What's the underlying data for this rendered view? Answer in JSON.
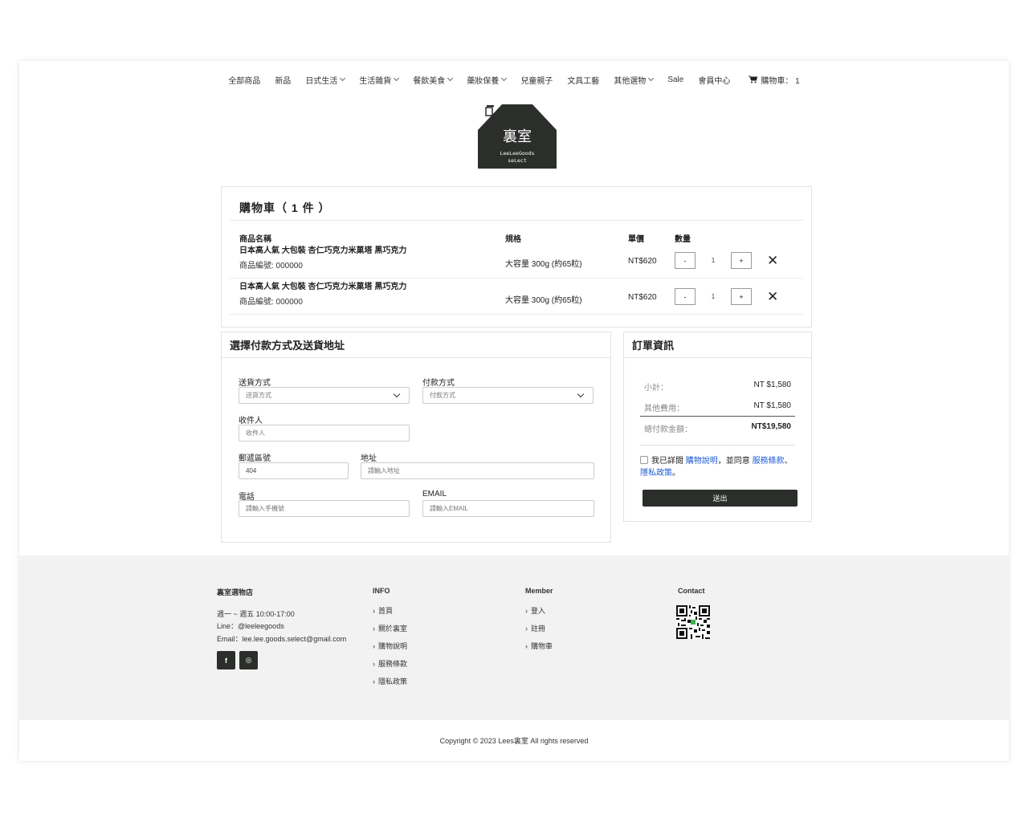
{
  "nav": {
    "items": [
      {
        "label": "全部商品",
        "has_dropdown": false
      },
      {
        "label": "新品",
        "has_dropdown": false
      },
      {
        "label": "日式生活",
        "has_dropdown": true
      },
      {
        "label": "生活雜貨",
        "has_dropdown": true
      },
      {
        "label": "餐飲美食",
        "has_dropdown": true
      },
      {
        "label": "藥妝保養",
        "has_dropdown": true
      },
      {
        "label": "兒童親子",
        "has_dropdown": false
      },
      {
        "label": "文具工藝",
        "has_dropdown": false
      },
      {
        "label": "其他選物",
        "has_dropdown": true
      },
      {
        "label": "Sale",
        "has_dropdown": false
      },
      {
        "label": "會員中心",
        "has_dropdown": false
      }
    ],
    "cart_label": "購物車： 1"
  },
  "logo": {
    "title": "裏室",
    "line1": "LeeLeeGoods",
    "line2": "seLect",
    "color": "#2b2e2a"
  },
  "cart": {
    "title": "購物車（ 1 件 ）",
    "headers": {
      "name": "商品名稱",
      "spec": "規格",
      "price": "單價",
      "qty": "數量"
    },
    "rows": [
      {
        "name": "日本高人氣 大包裝 杏仁巧克力米菓塔 黑巧克力",
        "code": "商品編號: 000000",
        "spec": "大容量 300g (約65粒)",
        "price": "NT$620",
        "qty": "1"
      },
      {
        "name": "日本高人氣 大包裝 杏仁巧克力米菓塔 黑巧克力",
        "code": "商品編號: 000000",
        "spec": "大容量 300g (約65粒)",
        "price": "NT$620",
        "qty": "1"
      }
    ],
    "minus": "-",
    "plus": "+",
    "remove": "✕"
  },
  "shipping": {
    "title": "選擇付款方式及送貨地址",
    "delivery_label": "送貨方式",
    "delivery_value": "送貨方式",
    "payment_label": "付款方式",
    "payment_value": "付款方式",
    "recipient_label": "收件人",
    "recipient_placeholder": "收件人",
    "zip_label": "郵遞區號",
    "zip_value": "404",
    "address_label": "地址",
    "address_placeholder": "請輸入地址",
    "phone_label": "電話",
    "phone_placeholder": "請輸入手機號",
    "email_label": "EMAIL",
    "email_placeholder": "請輸入EMAIL"
  },
  "order": {
    "title": "訂單資訊",
    "subtotal_label": "小計：",
    "subtotal_value": "NT $1,580",
    "fee_label": "其他費用：",
    "fee_value": "NT $1,580",
    "total_label": "總付款金額：",
    "total_value": "NT$19,580",
    "agree_prefix": "我已詳閱",
    "agree_link1": "購物說明",
    "agree_mid": "，並同意",
    "agree_link2": "服務條款",
    "agree_sep": "、",
    "agree_link3": "隱私政策",
    "agree_end": "。",
    "submit": "送出",
    "link_color": "#1f5bd6"
  },
  "footer": {
    "store": {
      "title": "裏室選物店",
      "hours": "週一 ~ 週五 10:00-17:00",
      "line": "Line：@leeleegoods",
      "email": "Email：lee.lee.goods.select@gmail.com",
      "facebook": "f",
      "instagram": "◎"
    },
    "info": {
      "title": "INFO",
      "links": [
        "首頁",
        "關於裏室",
        "購物說明",
        "服務條款",
        "隱私政策"
      ]
    },
    "member": {
      "title": "Member",
      "links": [
        "登入",
        "註冊",
        "購物車"
      ]
    },
    "contact": {
      "title": "Contact"
    },
    "copyright": "Copyright © 2023 Lees裏室 All rights reserved"
  }
}
